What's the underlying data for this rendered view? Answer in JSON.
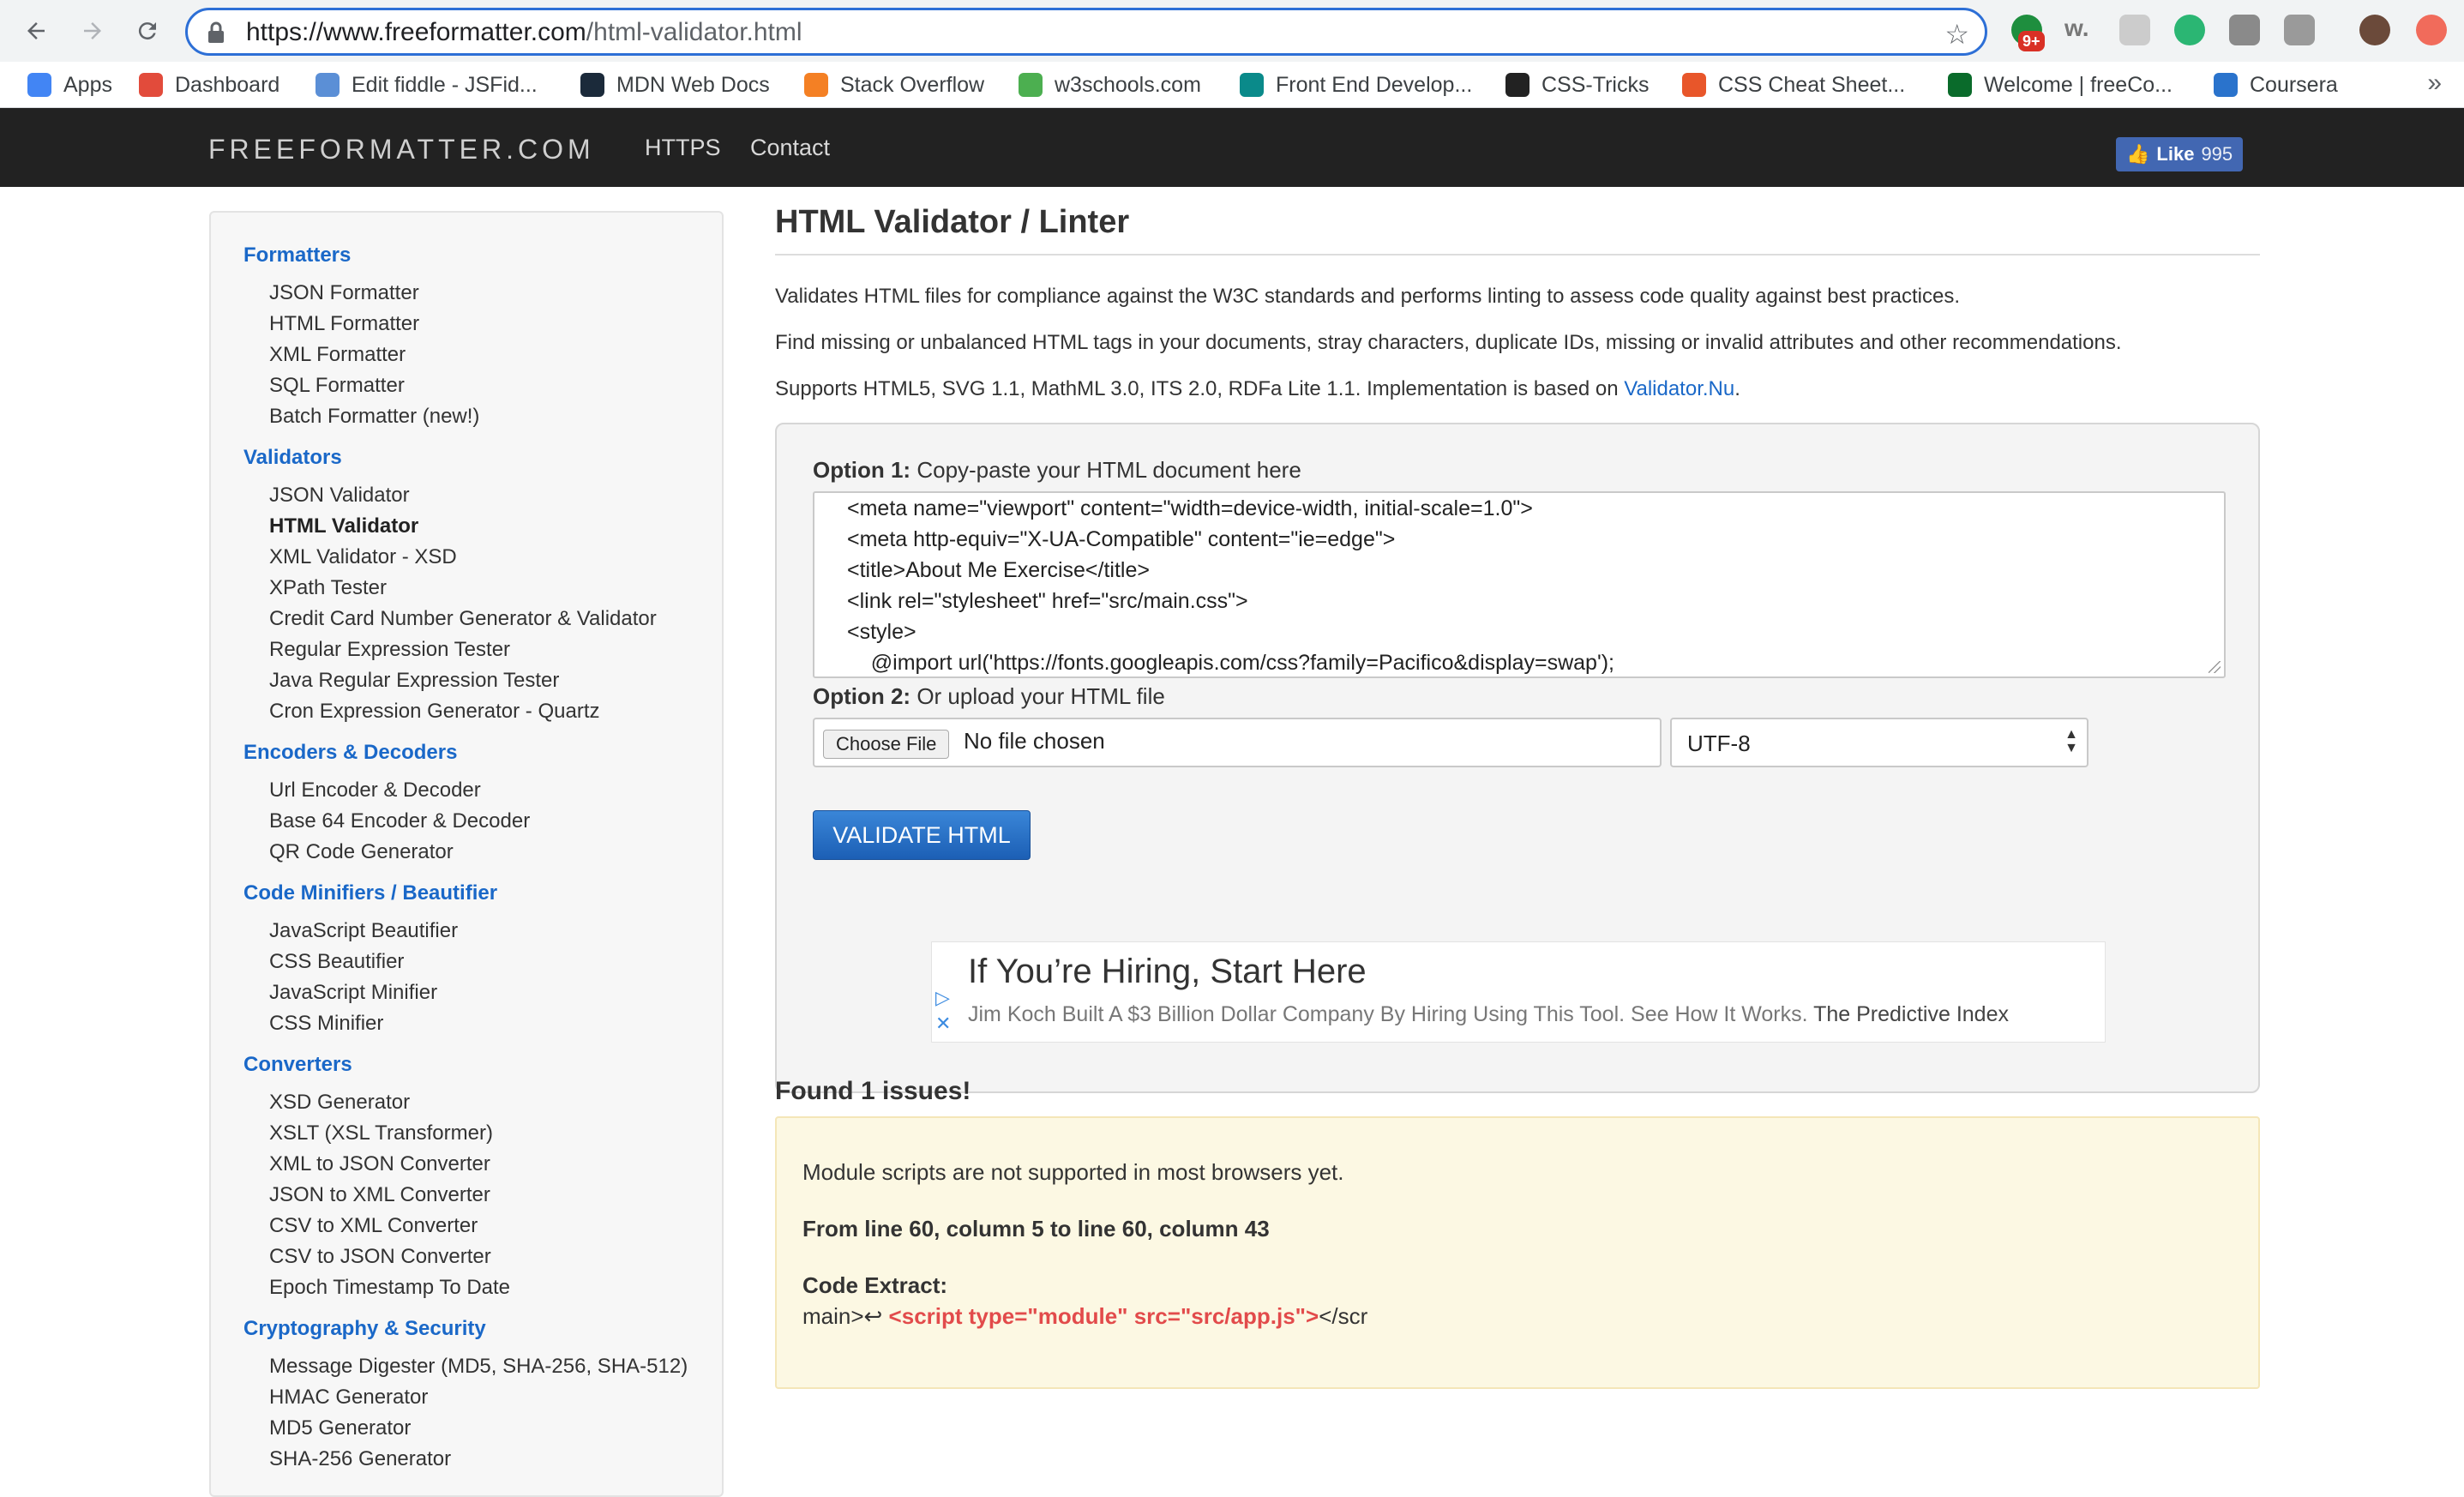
{
  "browser": {
    "url_domain": "https://www.freeformatter.com",
    "url_path": "/html-validator.html",
    "notification_badge": "9+",
    "bookmarks": [
      {
        "label": "Apps",
        "color": "#4285f4"
      },
      {
        "label": "Dashboard",
        "color": "#e24b3b"
      },
      {
        "label": "Edit fiddle - JSFid...",
        "color": "#5b8fd6"
      },
      {
        "label": "MDN Web Docs",
        "color": "#1b2a3a"
      },
      {
        "label": "Stack Overflow",
        "color": "#f48024"
      },
      {
        "label": "w3schools.com",
        "color": "#4caf50"
      },
      {
        "label": "Front End Develop...",
        "color": "#0a8a8a"
      },
      {
        "label": "CSS-Tricks",
        "color": "#222222"
      },
      {
        "label": "CSS Cheat Sheet...",
        "color": "#e8562a"
      },
      {
        "label": "Welcome | freeCo...",
        "color": "#0a6b2b"
      },
      {
        "label": "Coursera",
        "color": "#2a73cc"
      }
    ]
  },
  "site": {
    "brand": "FREEFORMATTER.COM",
    "nav": [
      "HTTPS",
      "Contact"
    ],
    "like_label": "Like",
    "like_count": "995"
  },
  "sidebar": {
    "sections": [
      {
        "title": "Formatters",
        "items": [
          "JSON Formatter",
          "HTML Formatter",
          "XML Formatter",
          "SQL Formatter",
          "Batch Formatter (new!)"
        ]
      },
      {
        "title": "Validators",
        "items": [
          "JSON Validator",
          "HTML Validator",
          "XML Validator - XSD",
          "XPath Tester",
          "Credit Card Number Generator & Validator",
          "Regular Expression Tester",
          "Java Regular Expression Tester",
          "Cron Expression Generator - Quartz"
        ]
      },
      {
        "title": "Encoders & Decoders",
        "items": [
          "Url Encoder & Decoder",
          "Base 64 Encoder & Decoder",
          "QR Code Generator"
        ]
      },
      {
        "title": "Code Minifiers / Beautifier",
        "items": [
          "JavaScript Beautifier",
          "CSS Beautifier",
          "JavaScript Minifier",
          "CSS Minifier"
        ]
      },
      {
        "title": "Converters",
        "items": [
          "XSD Generator",
          "XSLT (XSL Transformer)",
          "XML to JSON Converter",
          "JSON to XML Converter",
          "CSV to XML Converter",
          "CSV to JSON Converter",
          "Epoch Timestamp To Date"
        ]
      },
      {
        "title": "Cryptography & Security",
        "items": [
          "Message Digester (MD5, SHA-256, SHA-512)",
          "HMAC Generator",
          "MD5 Generator",
          "SHA-256 Generator"
        ]
      }
    ],
    "active_item": "HTML Validator"
  },
  "main": {
    "title": "HTML Validator / Linter",
    "intro": [
      "Validates HTML files for compliance against the W3C standards and performs linting to assess code quality against best practices.",
      "Find missing or unbalanced HTML tags in your documents, stray characters, duplicate IDs, missing or invalid attributes and other recommendations."
    ],
    "supports_prefix": "Supports HTML5, SVG 1.1, MathML 3.0, ITS 2.0, RDFa Lite 1.1. Implementation is based on ",
    "supports_link": "Validator.Nu",
    "supports_suffix": ".",
    "option1_label": "Option 1:",
    "option1_text": "Copy-paste your HTML document here",
    "code_lines": [
      "<meta name=\"viewport\" content=\"width=device-width, initial-scale=1.0\">",
      "<meta http-equiv=\"X-UA-Compatible\" content=\"ie=edge\">",
      "<title>About Me Exercise</title>",
      "<link rel=\"stylesheet\" href=\"src/main.css\">",
      "<style>",
      "    @import url('https://fonts.googleapis.com/css?family=Pacifico&display=swap');"
    ],
    "option2_label": "Option 2:",
    "option2_text": "Or upload your HTML file",
    "choose_file": "Choose File",
    "no_file": "No file chosen",
    "encoding": "UTF-8",
    "validate_button": "VALIDATE HTML"
  },
  "ad": {
    "headline": "If You’re Hiring, Start Here",
    "body": "Jim Koch Built A $3 Billion Dollar Company By Hiring Using This Tool. See How It Works.",
    "advertiser": "The Predictive Index"
  },
  "results": {
    "found": "Found 1 issues!",
    "message": "Module scripts are not supported in most browsers yet.",
    "location": "From line 60, column 5 to line 60, column 43",
    "extract_label": "Code Extract:",
    "extract_before": "main>↩ ",
    "extract_highlight": "<script type=\"module\" src=\"src/app.js\">",
    "extract_after": "</scr"
  }
}
